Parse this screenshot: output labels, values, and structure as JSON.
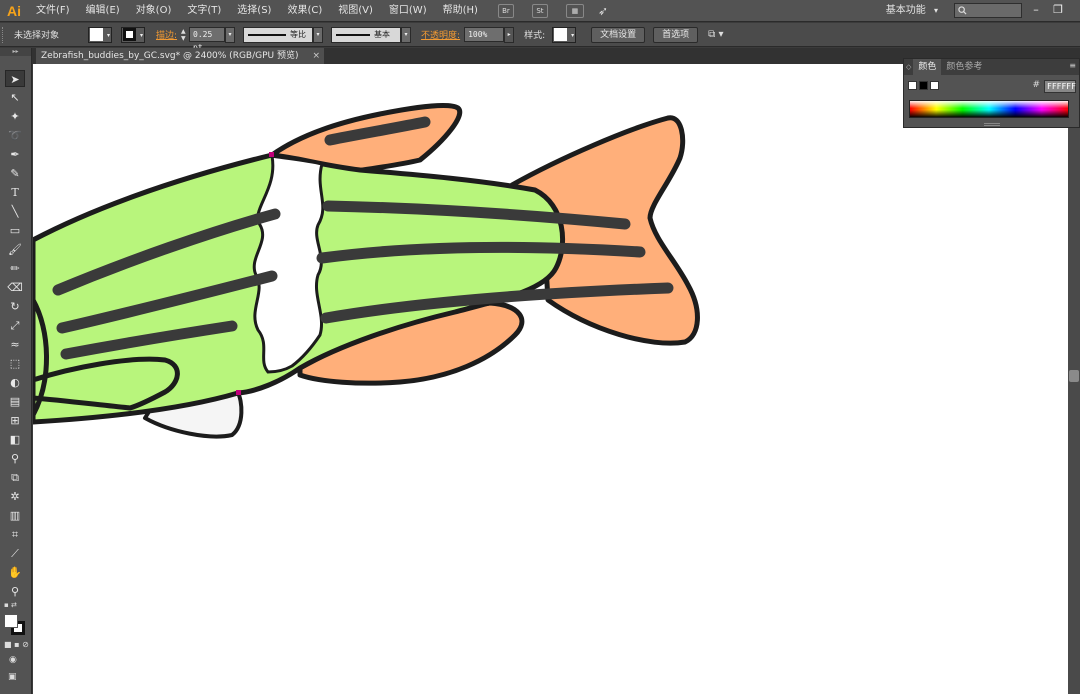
{
  "app": {
    "logo": "Ai"
  },
  "menu": {
    "items": [
      "文件(F)",
      "编辑(E)",
      "对象(O)",
      "文字(T)",
      "选择(S)",
      "效果(C)",
      "视图(V)",
      "窗口(W)",
      "帮助(H)"
    ],
    "bridge_icon": "Br",
    "stock_icon": "St",
    "workspace": "基本功能",
    "workspace_arrow": "▾"
  },
  "controls": {
    "selection_state": "未选择对象",
    "stroke_label": "描边:",
    "stroke_weight": "0.25 pt",
    "stroke_profile": "等比",
    "brush": "基本",
    "opacity_label": "不透明度:",
    "opacity_value": "100%",
    "style_label": "样式:",
    "document_setup_button": "文档设置",
    "preferences_button": "首选项"
  },
  "document": {
    "tab_title": "Zebrafish_buddies_by_GC.svg* @ 2400% (RGB/GPU 预览)",
    "close_glyph": "×"
  },
  "color_panel": {
    "tabs": [
      "颜色",
      "颜色参考"
    ],
    "hex_value": "FFFFFF",
    "hash": "#"
  },
  "colors": {
    "body_green": "#b8f57c",
    "fin_orange": "#ffaf7a",
    "stripe": "#3a3a3a",
    "outline": "#1c1c1c",
    "white_band": "#ffffff",
    "belly": "#f5f5f5",
    "anchor_point": "#c0007a",
    "logo_orange": "#f6a31a"
  }
}
